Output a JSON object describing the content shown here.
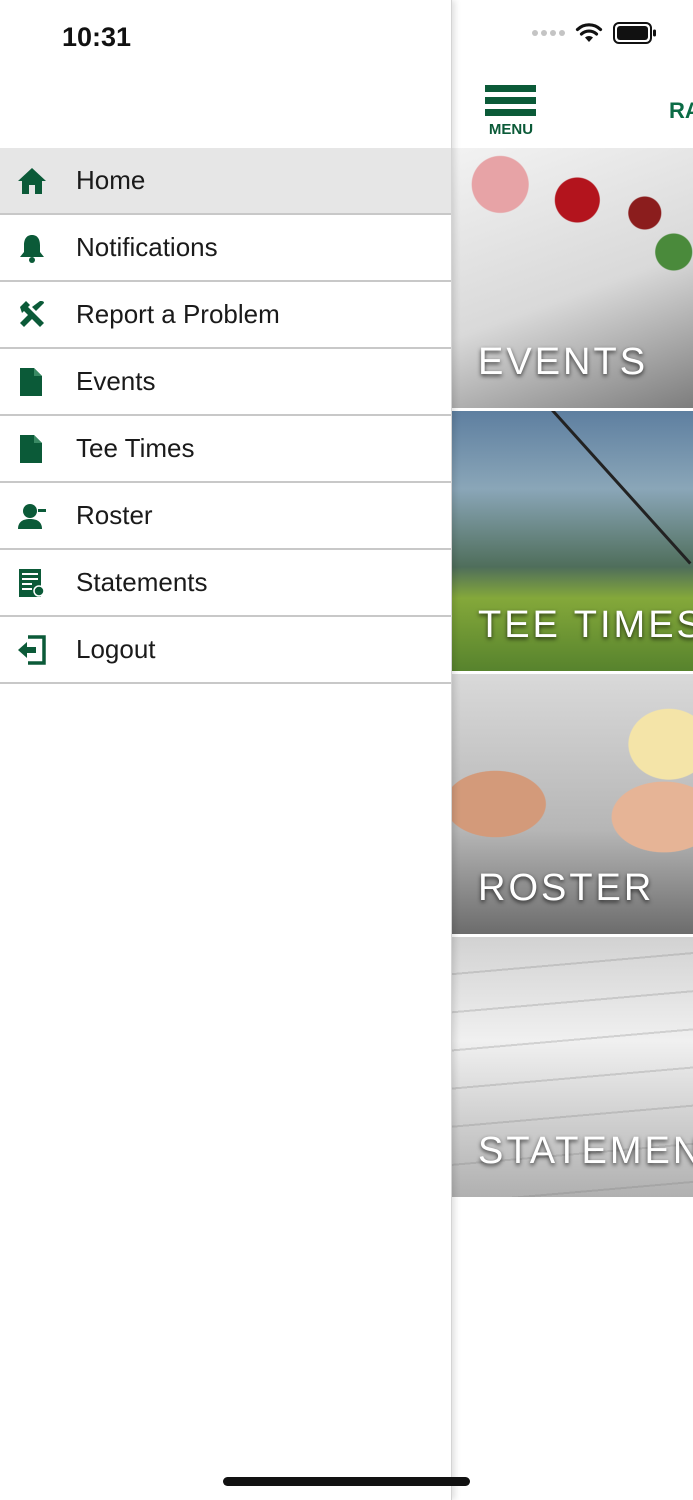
{
  "status_bar": {
    "time": "10:31"
  },
  "header": {
    "menu_label": "MENU",
    "title_partial": "RA"
  },
  "drawer": {
    "items": [
      {
        "label": "Home",
        "icon": "home-icon",
        "active": true
      },
      {
        "label": "Notifications",
        "icon": "bell-icon",
        "active": false
      },
      {
        "label": "Report a Problem",
        "icon": "tools-icon",
        "active": false
      },
      {
        "label": "Events",
        "icon": "document-icon",
        "active": false
      },
      {
        "label": "Tee Times",
        "icon": "document-icon",
        "active": false
      },
      {
        "label": "Roster",
        "icon": "user-icon",
        "active": false
      },
      {
        "label": "Statements",
        "icon": "statement-icon",
        "active": false
      },
      {
        "label": "Logout",
        "icon": "logout-icon",
        "active": false
      }
    ]
  },
  "tiles": [
    {
      "label": "EVENTS"
    },
    {
      "label": "TEE TIMES"
    },
    {
      "label": "ROSTER"
    },
    {
      "label": "STATEMENTS"
    }
  ],
  "colors": {
    "brand_green": "#0b5a38",
    "active_row": "#e6e6e6",
    "divider": "#c8c8c8"
  }
}
